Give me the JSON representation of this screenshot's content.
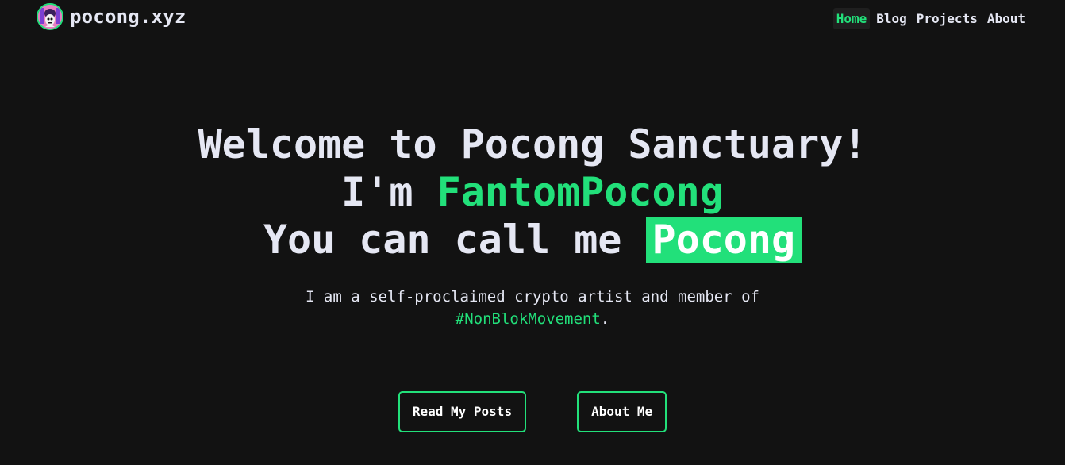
{
  "header": {
    "brand": "pocong.xyz",
    "logo_icon": "pocong-avatar-icon",
    "nav": [
      {
        "label": "Home",
        "active": true
      },
      {
        "label": "Blog",
        "active": false
      },
      {
        "label": "Projects",
        "active": false
      },
      {
        "label": "About",
        "active": false
      }
    ]
  },
  "hero": {
    "line1": "Welcome to Pocong Sanctuary!",
    "line2_prefix": "I'm ",
    "line2_name": "FantomPocong",
    "line3_prefix": "You can call me ",
    "line3_highlight": "Pocong",
    "intro_text": "I am a self-proclaimed crypto artist and member of ",
    "intro_hashtag": "#NonBlokMovement",
    "intro_suffix": "."
  },
  "buttons": {
    "read_posts": "Read My Posts",
    "about_me": "About Me"
  },
  "colors": {
    "background": "#121212",
    "accent": "#22e07a",
    "text": "#e5e7f3"
  }
}
